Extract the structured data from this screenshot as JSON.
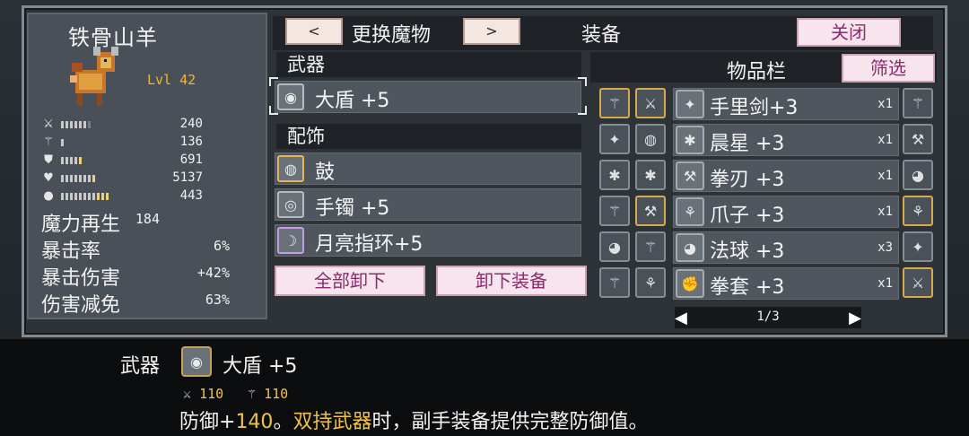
{
  "character": {
    "name": "铁骨山羊",
    "level": "Lvl 42",
    "stats": [
      {
        "icon": "sword-icon",
        "glyph": "⚔",
        "bars": 6,
        "yellow": 0,
        "value": "240"
      },
      {
        "icon": "wand-icon",
        "glyph": "⚚",
        "bars": 1,
        "yellow": 0,
        "value": "136"
      },
      {
        "icon": "shield-icon",
        "glyph": "⛊",
        "bars": 4,
        "yellow": 1,
        "value": "691"
      },
      {
        "icon": "heart-icon",
        "glyph": "♥",
        "bars": 7,
        "yellow": 1,
        "value": "5137"
      },
      {
        "icon": "mana-icon",
        "glyph": "●",
        "bars": 8,
        "yellow": 3,
        "value": "443"
      }
    ],
    "secondary": [
      {
        "label": "魔力再生",
        "value": "184"
      },
      {
        "label": "暴击率",
        "value": "6%"
      },
      {
        "label": "暴击伤害",
        "value": "+42%"
      },
      {
        "label": "伤害减免",
        "value": "63%"
      }
    ]
  },
  "header": {
    "prev": "<",
    "change_monster": "更换魔物",
    "next": ">",
    "equipment_title": "装备",
    "close": "关闭"
  },
  "equipment": {
    "weapon_header": "武器",
    "weapon": {
      "name": "大盾 +5",
      "glyph": "◉"
    },
    "accessory_header": "配饰",
    "accessories": [
      {
        "name": "鼓",
        "glyph": "◍",
        "border": "gold"
      },
      {
        "name": "手镯 +5",
        "glyph": "◎",
        "border": "normal"
      },
      {
        "name": "月亮指环+5",
        "glyph": "☽",
        "border": "purple"
      }
    ],
    "unequip_all": "全部卸下",
    "unequip": "卸下装备"
  },
  "inventory": {
    "title": "物品栏",
    "filter": "筛选",
    "items": [
      {
        "name": "手里剑+3",
        "qty": "x1",
        "glyph": "✦"
      },
      {
        "name": "晨星 +3",
        "qty": "x1",
        "glyph": "✱"
      },
      {
        "name": "拳刃 +3",
        "qty": "x1",
        "glyph": "⚒"
      },
      {
        "name": "爪子 +3",
        "qty": "x1",
        "glyph": "⚘"
      },
      {
        "name": "法球 +3",
        "qty": "x3",
        "glyph": "◕"
      },
      {
        "name": "拳套 +3",
        "qty": "x1",
        "glyph": "✊"
      }
    ],
    "left_col1": [
      "⚚",
      "✦",
      "✱",
      "⚚",
      "◕",
      "⚚"
    ],
    "left_col2": [
      "⚔",
      "◍",
      "✱",
      "⚒",
      "⚚",
      "⚘"
    ],
    "right_col": [
      "⚚",
      "⚒",
      "◕",
      "⚘",
      "✦",
      "⚔"
    ],
    "page": "1/3",
    "page_prev": "◀",
    "page_next": "▶"
  },
  "tooltip": {
    "category": "武器",
    "name": "大盾 +5",
    "glyph": "◉",
    "atk_icon": "⚔",
    "atk": "110",
    "mag_icon": "⚚",
    "mag": "110",
    "desc_prefix": "防御+",
    "desc_value": "140",
    "desc_mid": "。",
    "desc_highlight": "双持武器",
    "desc_suffix": "时，副手装备提供完整防御值。"
  },
  "colors": {
    "accent_gold": "#f0c24a",
    "button_pink_text": "#8a2c6e",
    "panel": "#4a5057"
  }
}
